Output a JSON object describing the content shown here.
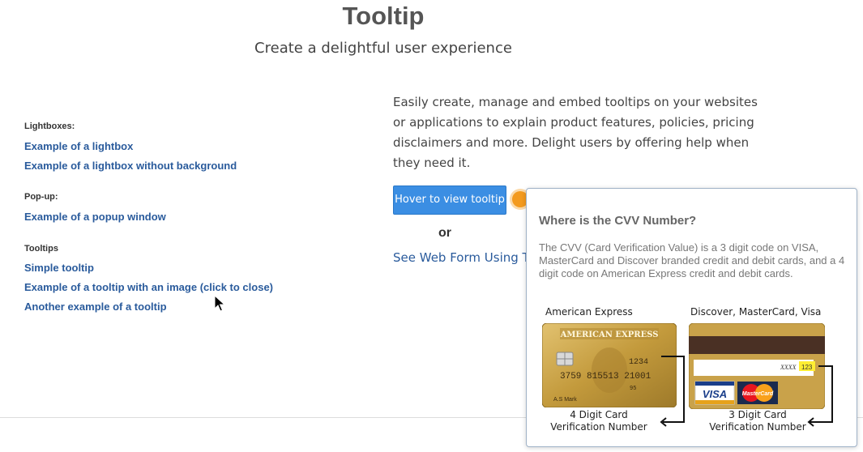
{
  "header": {
    "title": "Tooltip",
    "subtitle": "Create a delightful user experience"
  },
  "sidebar": {
    "sections": [
      {
        "heading": "Lightboxes:",
        "links": [
          "Example of a lightbox",
          "Example of a lightbox without background"
        ]
      },
      {
        "heading": "Pop-up:",
        "links": [
          "Example of a popup window"
        ]
      },
      {
        "heading": "Tooltips",
        "links": [
          "Simple tooltip",
          "Example of a tooltip with an image (click to close)",
          "Another example of a tooltip"
        ]
      }
    ]
  },
  "main": {
    "description": "Easily create, manage and embed tooltips on your websites or applications to explain product features, policies, pricing disclaimers and more. Delight users by offering help when they need it.",
    "hover_button": "Hover to view tooltip",
    "or_text": "or",
    "web_form_link": "See Web Form Using Tooltips"
  },
  "tooltip": {
    "title": "Where is the CVV Number?",
    "body": "The CVV (Card Verification Value) is a 3 digit code on VISA, MasterCard and Discover branded credit and debit cards, and a 4 digit code on American Express credit and debit cards.",
    "amex": {
      "label": "American Express",
      "brand": "AMERICAN EXPRESS",
      "cvv": "1234",
      "number": "3759  815513  21001",
      "small": "95",
      "name": "A.S Mark",
      "caption_line1": "4 Digit Card",
      "caption_line2": "Verification Number"
    },
    "visa": {
      "label": "Discover, MasterCard, Visa",
      "masked": "XXXX",
      "cvv": "123",
      "visa_logo": "VISA",
      "mc_logo": "MasterCard",
      "caption_line1": "3 Digit Card",
      "caption_line2": "Verification Number"
    }
  },
  "colors": {
    "link": "#2a5b9c",
    "button": "#3b8ee3",
    "dot": "#f39a1e",
    "card_gold": "#c9a24a"
  }
}
